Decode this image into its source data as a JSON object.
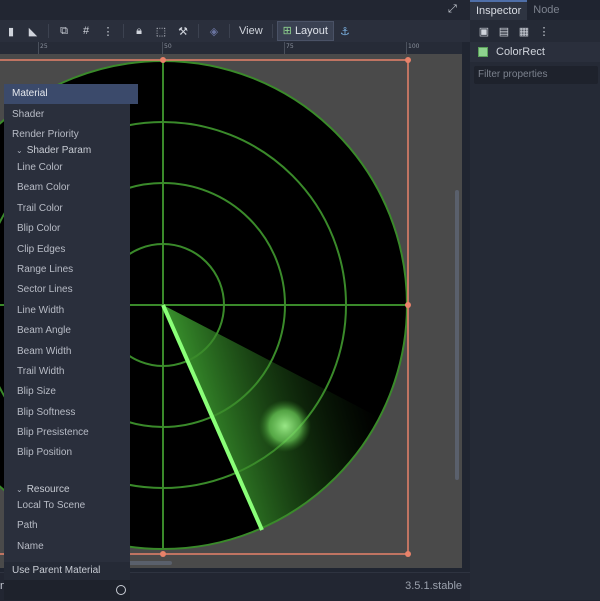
{
  "toolbar": {
    "view_label": "View",
    "layout_label": "Layout"
  },
  "ruler": {
    "labels": [
      "25",
      "50",
      "75",
      "100"
    ]
  },
  "bottombar": {
    "left_label": "nimation",
    "version": "3.5.1.stable"
  },
  "inspector": {
    "tabs": [
      {
        "label": "Inspector",
        "active": true
      },
      {
        "label": "Node",
        "active": false
      }
    ],
    "object_name": "ColorRect",
    "filter_placeholder": "Filter properties",
    "properties": {
      "material": "Material",
      "shader": "Shader",
      "render_priority": "Render Priority",
      "shader_param_section": "Shader Param",
      "params": [
        "Line Color",
        "Beam Color",
        "Trail Color",
        "Blip Color",
        "Clip Edges",
        "Range Lines",
        "Sector Lines",
        "Line Width",
        "Beam Angle",
        "Beam Width",
        "Trail Width",
        "Blip Size",
        "Blip Softness",
        "Blip Presistence",
        "Blip Position"
      ],
      "resource_section": "Resource",
      "resource_items": [
        "Local To Scene",
        "Path",
        "Name"
      ]
    },
    "use_parent_material": "Use Parent Material"
  },
  "colors": {
    "radar_line": "#3a8a2a",
    "beam": "#7cff6a",
    "selection": "#e8826a"
  }
}
